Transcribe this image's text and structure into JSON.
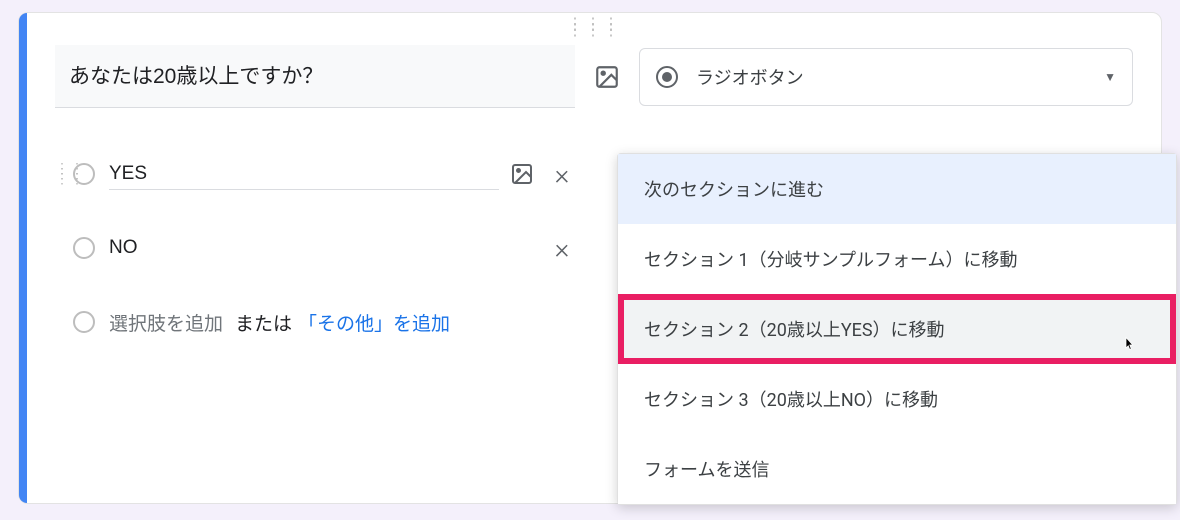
{
  "question": {
    "text": "あなたは20歳以上ですか？"
  },
  "type_selector": {
    "label": "ラジオボタン"
  },
  "options": [
    {
      "label": "YES",
      "has_image_btn": true
    },
    {
      "label": "NO",
      "has_image_btn": false
    }
  ],
  "add_option": {
    "placeholder": "選択肢を追加",
    "or": "または",
    "other_link": "「その他」を追加"
  },
  "goto_menu": {
    "items": [
      {
        "label": "次のセクションに進む",
        "state": "selected"
      },
      {
        "label": "セクション 1（分岐サンプルフォーム）に移動",
        "state": ""
      },
      {
        "label": "セクション 2（20歳以上YES）に移動",
        "state": "highlighted"
      },
      {
        "label": "セクション 3（20歳以上NO）に移動",
        "state": ""
      },
      {
        "label": "フォームを送信",
        "state": ""
      }
    ]
  }
}
